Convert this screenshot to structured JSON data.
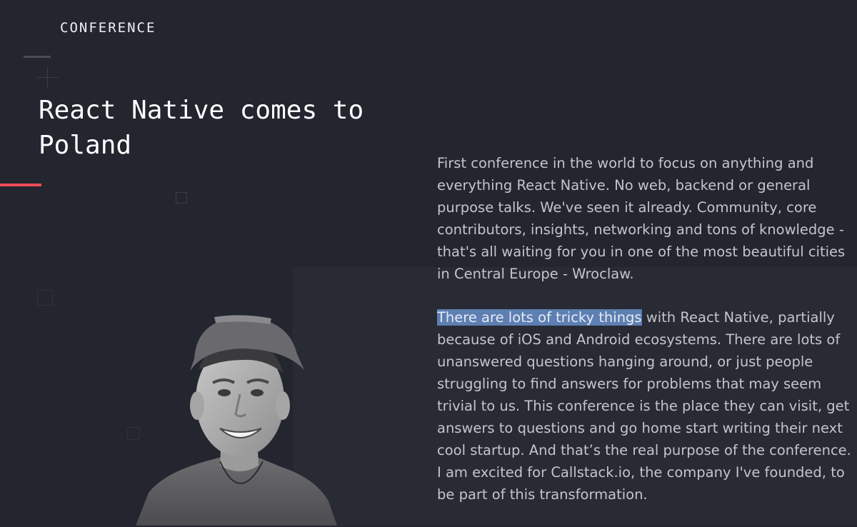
{
  "header": {
    "section_label": "CONFERENCE"
  },
  "hero": {
    "title": "React Native comes to Poland",
    "accent_color": "#ee4b55"
  },
  "article": {
    "paragraph1": "First conference in the world to focus on anything and everything React Native. No web, backend or general purpose talks. We've seen it already. Community, core contributors, insights, networking and tons of knowledge - that's all waiting for you in one of the most beautiful cities in Central Europe - Wroclaw.",
    "paragraph2_highlight": "There are lots of tricky things",
    "paragraph2_rest": " with React Native, partially because of iOS and Android ecosystems. There are lots of unanswered questions hanging around, or just people struggling to find answers for problems that may seem trivial to us. This conference is the place they can visit, get answers to questions and go home start writing their next cool startup. And that’s the real purpose of the conference. I am excited for Callstack.io, the company I've founded, to be part of this transformation.",
    "highlight_color": "#5d7fb2"
  },
  "photo": {
    "icon": "person-portrait"
  }
}
